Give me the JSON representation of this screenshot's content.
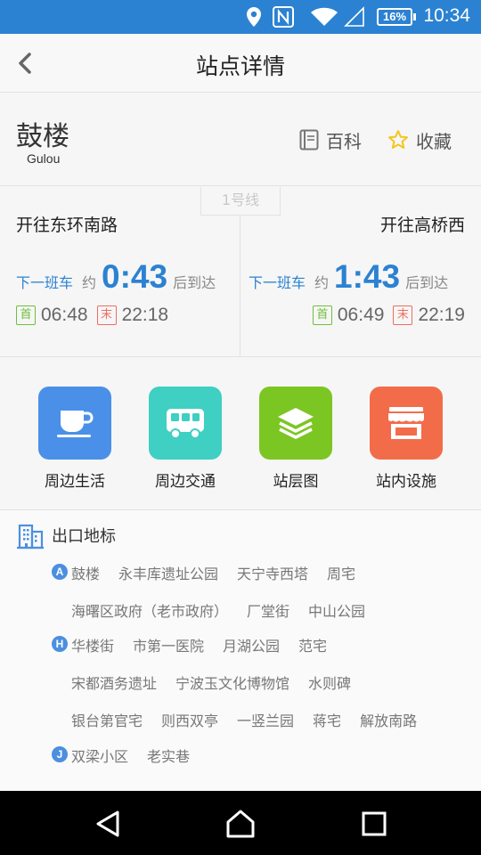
{
  "status_bar": {
    "battery": "16%",
    "time": "10:34",
    "icons": [
      "location-icon",
      "nfc-icon",
      "wifi-icon",
      "signal-icon",
      "battery-icon"
    ]
  },
  "header": {
    "title": "站点详情",
    "back_icon": "chevron-left-icon"
  },
  "station": {
    "name": "鼓楼",
    "pinyin": "Gulou",
    "wiki_label": "百科",
    "favorite_label": "收藏"
  },
  "line": {
    "name": "1号线"
  },
  "directions": [
    {
      "name": "开往东环南路",
      "next_label": "下一班车",
      "approx": "约",
      "countdown": "0:43",
      "arrive": "后到达",
      "first_badge": "首",
      "first_time": "06:48",
      "last_badge": "末",
      "last_time": "22:18"
    },
    {
      "name": "开往高桥西",
      "next_label": "下一班车",
      "approx": "约",
      "countdown": "1:43",
      "arrive": "后到达",
      "first_badge": "首",
      "first_time": "06:49",
      "last_badge": "末",
      "last_time": "22:19"
    }
  ],
  "services": [
    {
      "label": "周边生活",
      "icon": "coffee-cup-icon",
      "color": "#4a90e8"
    },
    {
      "label": "周边交通",
      "icon": "bus-icon",
      "color": "#3fcfc3"
    },
    {
      "label": "站层图",
      "icon": "layers-icon",
      "color": "#7cc623"
    },
    {
      "label": "站内设施",
      "icon": "shop-icon",
      "color": "#f36c4a"
    }
  ],
  "exits": {
    "title": "出口地标",
    "groups": [
      {
        "exit": "A",
        "rows": [
          [
            "鼓楼",
            "永丰库遗址公园",
            "天宁寺西塔",
            "周宅"
          ],
          [
            "海曙区政府（老市政府）",
            "厂堂街",
            "中山公园"
          ]
        ]
      },
      {
        "exit": "H",
        "rows": [
          [
            "华楼街",
            "市第一医院",
            "月湖公园",
            "范宅"
          ],
          [
            "宋都酒务遗址",
            "宁波玉文化博物馆",
            "水则碑"
          ],
          [
            "银台第官宅",
            "则西双亭",
            "一竖兰园",
            "蒋宅",
            "解放南路"
          ]
        ]
      },
      {
        "exit": "J",
        "rows": [
          [
            "双梁小区",
            "老实巷"
          ]
        ]
      }
    ]
  },
  "colors": {
    "primary": "#2b82d2",
    "first_badge": "#6fbf3b",
    "last_badge": "#ef6d5f"
  }
}
